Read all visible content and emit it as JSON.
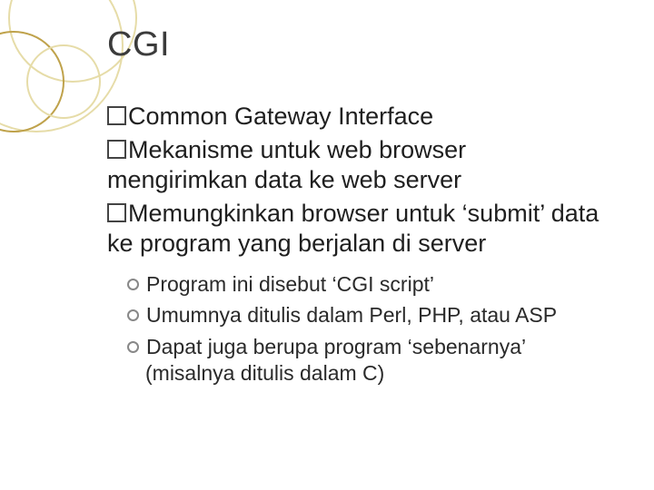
{
  "title": "CGI",
  "bullets": {
    "b1": "Common Gateway Interface",
    "b2": "Mekanisme untuk web browser mengirimkan data ke web server",
    "b3": "Memungkinkan browser untuk ‘submit’ data ke program yang berjalan di server"
  },
  "subbullets": {
    "s1": "Program ini disebut ‘CGI script’",
    "s2": "Umumnya ditulis dalam Perl, PHP, atau ASP",
    "s3": "Dapat juga berupa program ‘sebenarnya’ (misalnya ditulis dalam C)"
  }
}
